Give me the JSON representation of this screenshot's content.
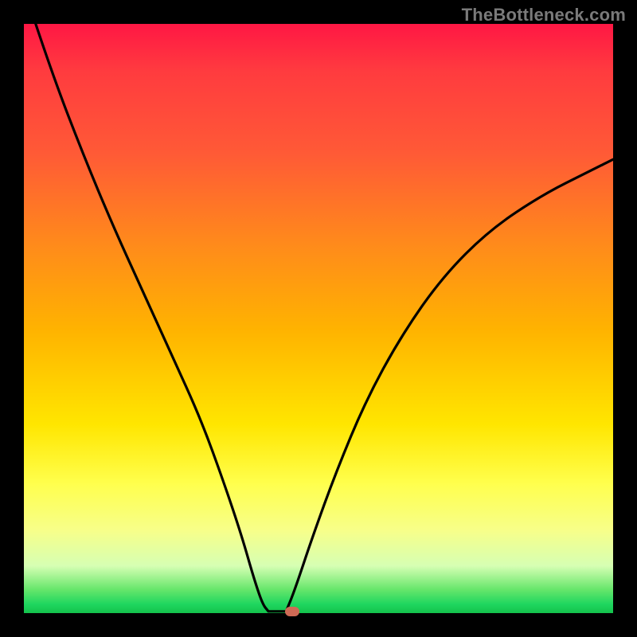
{
  "watermark": "TheBottleneck.com",
  "colors": {
    "frame": "#000000",
    "gradient_top": "#ff1744",
    "gradient_mid1": "#ff8c1a",
    "gradient_mid2": "#ffe600",
    "gradient_bottom": "#14c24b",
    "curve": "#000000",
    "marker": "#cf6a55"
  },
  "chart_data": {
    "type": "line",
    "title": "",
    "xlabel": "",
    "ylabel": "",
    "xlim": [
      0,
      100
    ],
    "ylim": [
      0,
      100
    ],
    "grid": false,
    "legend": false,
    "series": [
      {
        "name": "left-branch",
        "x": [
          2,
          5,
          10,
          15,
          20,
          25,
          30,
          34,
          37,
          39,
          40.5,
          41.5
        ],
        "values": [
          100,
          91,
          78,
          66,
          55,
          44,
          33,
          22,
          13,
          6,
          1.5,
          0.3
        ]
      },
      {
        "name": "flat-valley",
        "x": [
          41.5,
          44.5
        ],
        "values": [
          0.3,
          0.3
        ]
      },
      {
        "name": "right-branch",
        "x": [
          44.5,
          46,
          49,
          53,
          58,
          64,
          71,
          79,
          88,
          96,
          100
        ],
        "values": [
          0.3,
          4,
          13,
          24,
          36,
          47,
          57,
          65,
          71,
          75,
          77
        ]
      }
    ],
    "marker": {
      "x": 45.5,
      "y": 0.3
    },
    "annotations": [
      {
        "text": "TheBottleneck.com",
        "pos": "top-right"
      }
    ]
  }
}
